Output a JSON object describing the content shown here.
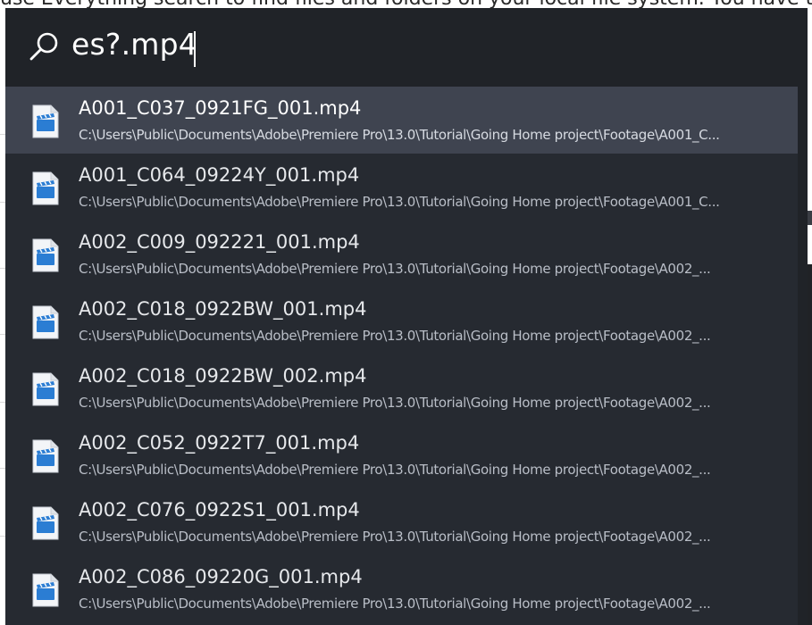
{
  "background_page": {
    "partial_text": "use Everything search to find files and folders on your local file system. You have to in"
  },
  "search": {
    "query": "es?.mp4",
    "icon": "search-icon"
  },
  "results": [
    {
      "name": "A001_C037_0921FG_001.mp4",
      "path": "C:\\Users\\Public\\Documents\\Adobe\\Premiere Pro\\13.0\\Tutorial\\Going Home project\\Footage\\A001_C...",
      "icon": "video-file-icon",
      "selected": true
    },
    {
      "name": "A001_C064_09224Y_001.mp4",
      "path": "C:\\Users\\Public\\Documents\\Adobe\\Premiere Pro\\13.0\\Tutorial\\Going Home project\\Footage\\A001_C...",
      "icon": "video-file-icon",
      "selected": false
    },
    {
      "name": "A002_C009_092221_001.mp4",
      "path": "C:\\Users\\Public\\Documents\\Adobe\\Premiere Pro\\13.0\\Tutorial\\Going Home project\\Footage\\A002_...",
      "icon": "video-file-icon",
      "selected": false
    },
    {
      "name": "A002_C018_0922BW_001.mp4",
      "path": "C:\\Users\\Public\\Documents\\Adobe\\Premiere Pro\\13.0\\Tutorial\\Going Home project\\Footage\\A002_...",
      "icon": "video-file-icon",
      "selected": false
    },
    {
      "name": "A002_C018_0922BW_002.mp4",
      "path": "C:\\Users\\Public\\Documents\\Adobe\\Premiere Pro\\13.0\\Tutorial\\Going Home project\\Footage\\A002_...",
      "icon": "video-file-icon",
      "selected": false
    },
    {
      "name": "A002_C052_0922T7_001.mp4",
      "path": "C:\\Users\\Public\\Documents\\Adobe\\Premiere Pro\\13.0\\Tutorial\\Going Home project\\Footage\\A002_...",
      "icon": "video-file-icon",
      "selected": false
    },
    {
      "name": "A002_C076_0922S1_001.mp4",
      "path": "C:\\Users\\Public\\Documents\\Adobe\\Premiere Pro\\13.0\\Tutorial\\Going Home project\\Footage\\A002_...",
      "icon": "video-file-icon",
      "selected": false
    },
    {
      "name": "A002_C086_09220G_001.mp4",
      "path": "C:\\Users\\Public\\Documents\\Adobe\\Premiere Pro\\13.0\\Tutorial\\Going Home project\\Footage\\A002_...",
      "icon": "video-file-icon",
      "selected": false
    }
  ],
  "colors": {
    "launcher_bg": "#202328",
    "results_bg": "#262a31",
    "selected_bg": "#3f4450",
    "text": "#ffffff",
    "path_text": "#b9bec7"
  }
}
